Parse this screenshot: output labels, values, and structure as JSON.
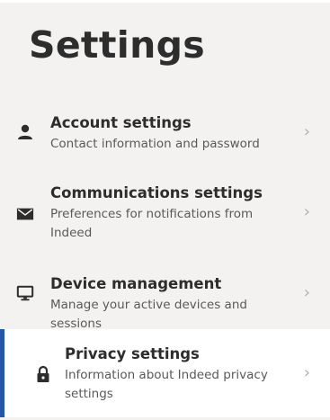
{
  "page": {
    "title": "Settings"
  },
  "nav": {
    "items": [
      {
        "icon": "person-icon",
        "label": "Account settings",
        "description": "Contact information and password"
      },
      {
        "icon": "mail-icon",
        "label": "Communications settings",
        "description": "Preferences for notifications from Indeed"
      },
      {
        "icon": "monitor-icon",
        "label": "Device management",
        "description": "Manage your active devices and sessions"
      },
      {
        "icon": "lock-icon",
        "label": "Privacy settings",
        "description": "Information about Indeed privacy settings",
        "active": true
      }
    ]
  },
  "colors": {
    "background": "#f3f2f1",
    "active_background": "#ffffff",
    "active_accent": "#2557a7",
    "text_primary": "#2d2d2d",
    "text_secondary": "#595959"
  }
}
